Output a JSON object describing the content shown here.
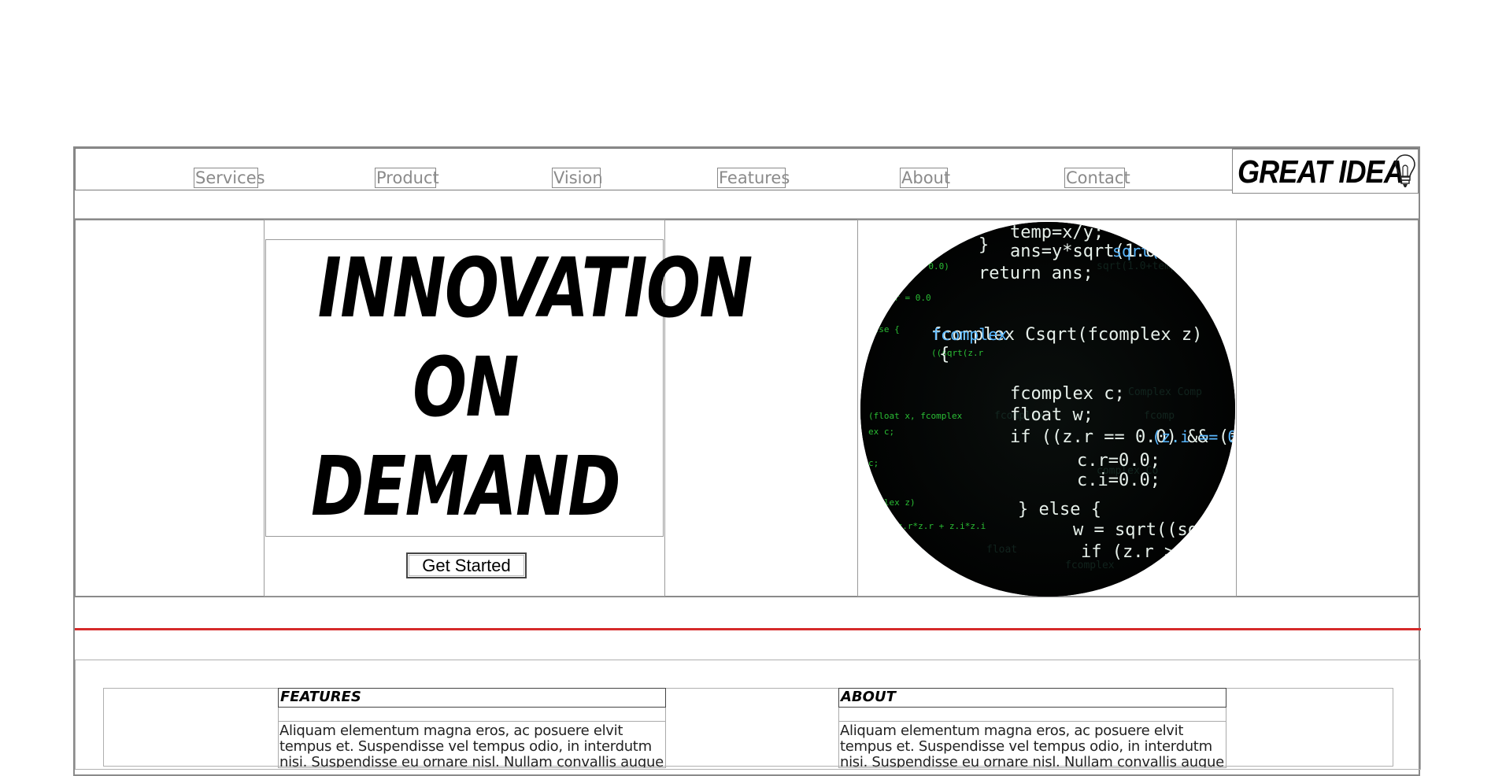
{
  "nav": {
    "links": [
      "Services",
      "Product",
      "Vision",
      "Features",
      "About",
      "Contact"
    ],
    "logo_text": "GREAT IDEA"
  },
  "hero": {
    "headline": [
      "INNOVATION",
      "ON",
      "DEMAND"
    ],
    "cta_label": "Get Started",
    "image_icon": "code-screen-image"
  },
  "sections": [
    {
      "heading": "FEATURES",
      "body": "Aliquam elementum magna eros, ac posuere elvit tempus et. Suspendisse vel tempus odio, in interdutm nisi. Suspendisse eu ornare nisl. Nullam convallis augue justo"
    },
    {
      "heading": "ABOUT",
      "body": "Aliquam elementum magna eros, ac posuere elvit tempus et. Suspendisse vel tempus odio, in interdutm nisi. Suspendisse eu ornare nisl. Nullam convallis augue justo"
    }
  ],
  "colors": {
    "divider": "#d62b2b",
    "border": "#8a8a8a",
    "nav_text": "#8a8a8a"
  }
}
